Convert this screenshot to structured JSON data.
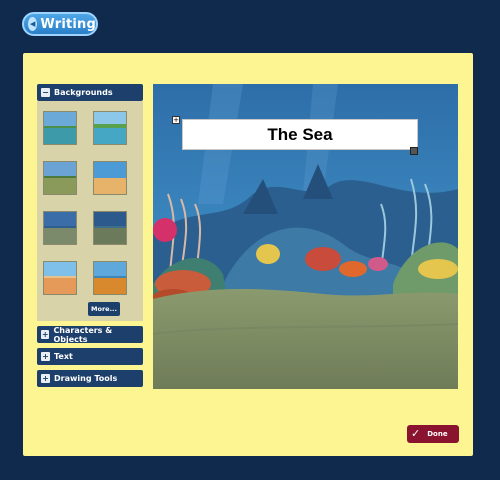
{
  "header": {
    "back_label": "Writing",
    "back_icon": "back-arrow-icon"
  },
  "sidebar": {
    "backgrounds": {
      "label": "Backgrounds",
      "toggle": "−",
      "more_label": "More..."
    },
    "sections": [
      {
        "label": "Characters & Objects",
        "toggle": "+"
      },
      {
        "label": "Text",
        "toggle": "+"
      },
      {
        "label": "Drawing Tools",
        "toggle": "+"
      }
    ]
  },
  "scene": {
    "title_text": "The Sea",
    "move_handle": "+",
    "resize_handle": "↘"
  },
  "footer": {
    "done_label": "Done",
    "done_icon": "✓"
  },
  "colors": {
    "page_bg": "#0f2a4d",
    "panel_bg": "#fdf592",
    "section_header": "#1d3f6b",
    "done_button": "#8a1330",
    "back_pill": "#2a7fc9"
  }
}
